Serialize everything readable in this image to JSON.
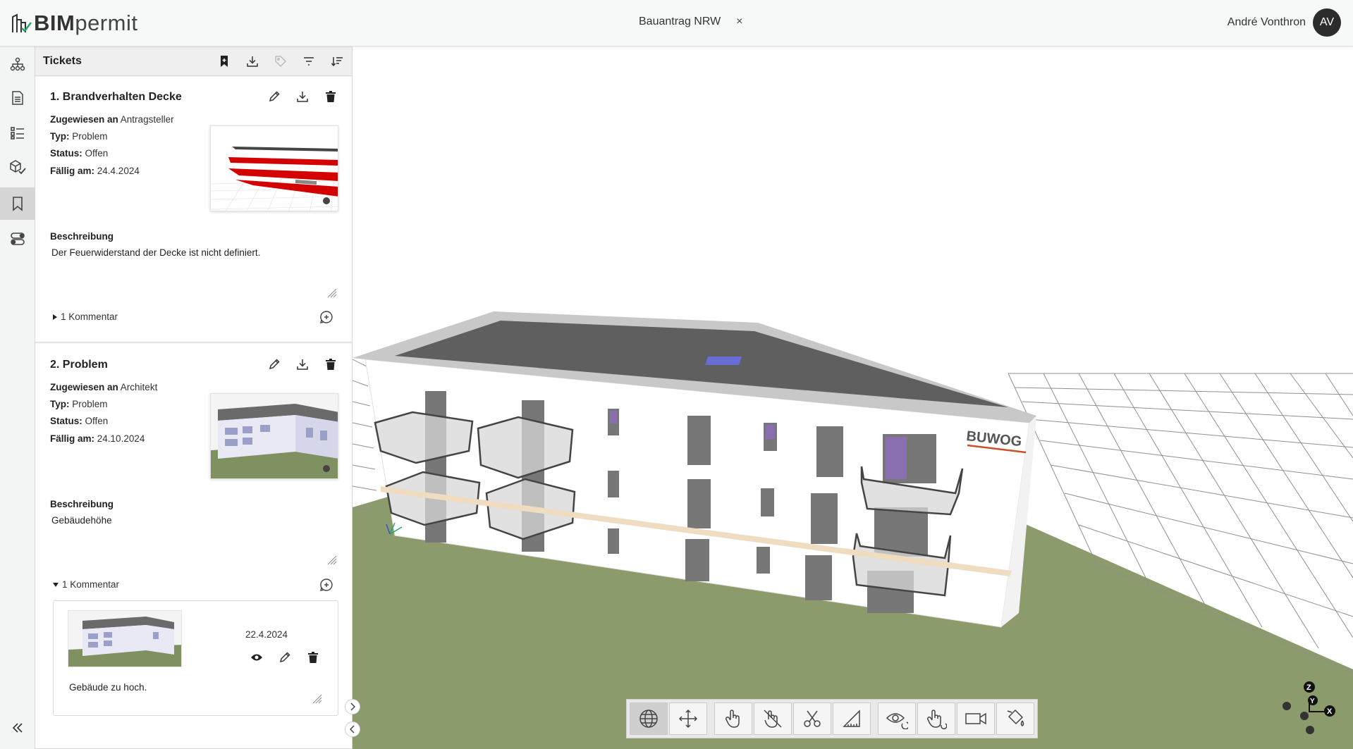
{
  "app": {
    "logo_bold": "BIM",
    "logo_light": "permit",
    "document_tab": "Bauantrag NRW",
    "close_glyph": "×",
    "user_name": "André Vonthron",
    "user_initials": "AV"
  },
  "rail": {
    "items": [
      {
        "icon": "hierarchy-icon"
      },
      {
        "icon": "document-icon"
      },
      {
        "icon": "checklist-icon"
      },
      {
        "icon": "model-check-icon"
      },
      {
        "icon": "bookmark-icon",
        "active": true
      },
      {
        "icon": "toggles-icon"
      }
    ],
    "collapse_glyph": "«"
  },
  "panel": {
    "title": "Tickets",
    "tools": [
      "bookmark-icon",
      "download-icon",
      "tag-icon",
      "filter-icon",
      "sort-icon"
    ]
  },
  "tickets": [
    {
      "title": "1. Brandverhalten Decke",
      "assigned_label": "Zugewiesen an",
      "assigned_value": "Antragsteller",
      "type_label": "Typ:",
      "type_value": "Problem",
      "status_label": "Status:",
      "status_value": "Offen",
      "due_label": "Fällig am:",
      "due_value": "24.4.2024",
      "desc_label": "Beschreibung",
      "desc_value": "Der Feuerwiderstand der Decke ist nicht definiert.",
      "comment_toggle": "1 Kommentar"
    },
    {
      "title": "2. Problem",
      "assigned_label": "Zugewiesen an",
      "assigned_value": "Architekt",
      "type_label": "Typ:",
      "type_value": "Problem",
      "status_label": "Status:",
      "status_value": "Offen",
      "due_label": "Fällig am:",
      "due_value": "24.10.2024",
      "desc_label": "Beschreibung",
      "desc_value": "Gebäudehöhe",
      "comment_toggle": "1 Kommentar",
      "comment": {
        "date": "22.4.2024",
        "text": "Gebäude zu hoch."
      }
    }
  ],
  "viewer": {
    "sign_text": "BUWOG",
    "axis_labels": {
      "x": "X",
      "y": "Y",
      "z": "Z"
    },
    "colors": {
      "ground": "#8a9a6a",
      "roof": "#5f5f5f",
      "wall": "#ffffff",
      "accent": "#c8502a"
    },
    "toolbar": [
      [
        "globe-icon",
        "move-icon"
      ],
      [
        "hand-select-icon",
        "hide-icon",
        "section-cut-icon",
        "measure-icon"
      ],
      [
        "eye-rotate-icon",
        "pan-hand-icon",
        "camera-icon",
        "paint-icon"
      ]
    ]
  }
}
